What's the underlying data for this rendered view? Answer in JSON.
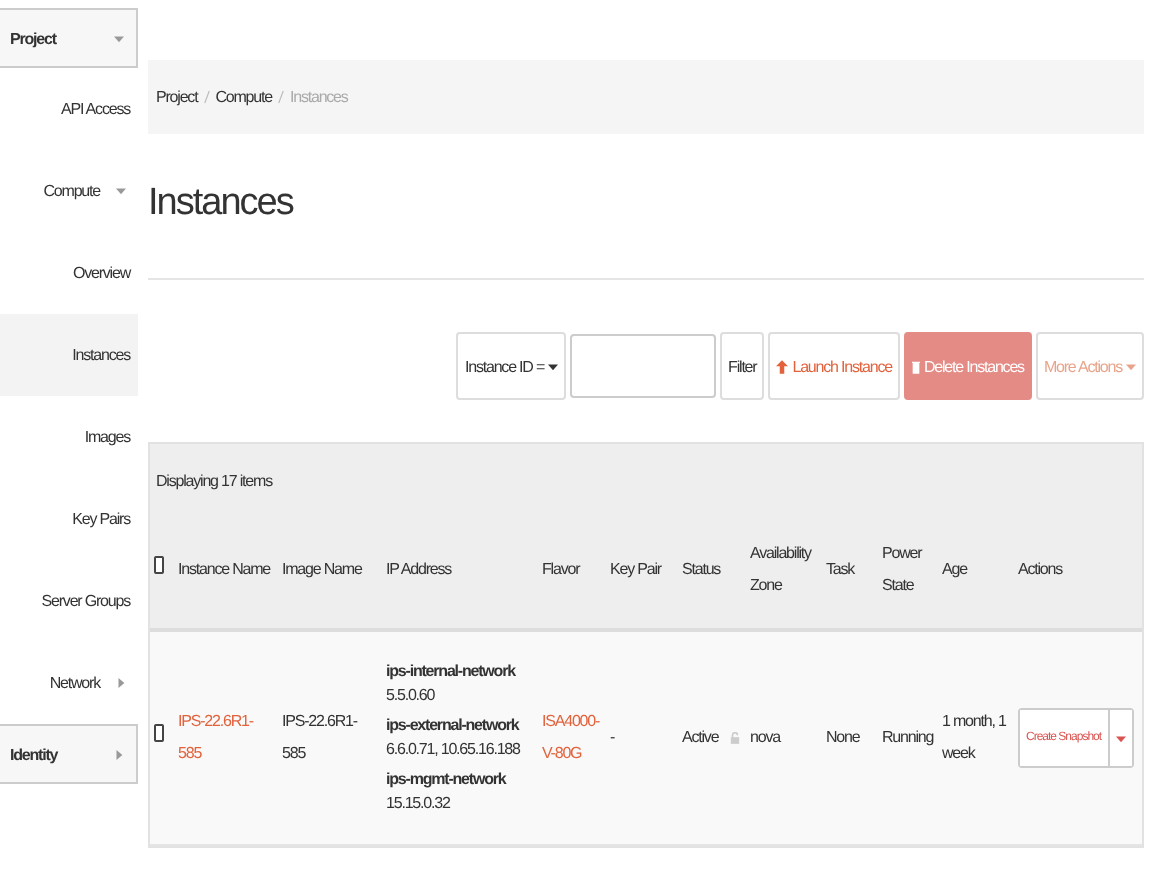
{
  "sidebar": {
    "items": [
      {
        "kind": "section",
        "label": "Project",
        "expanded": true
      },
      {
        "kind": "item",
        "label": "API Access",
        "selected": false
      },
      {
        "kind": "group",
        "label": "Compute",
        "expanded": true
      },
      {
        "kind": "item",
        "label": "Overview",
        "selected": false
      },
      {
        "kind": "item",
        "label": "Instances",
        "selected": true
      },
      {
        "kind": "item",
        "label": "Images",
        "selected": false
      },
      {
        "kind": "item",
        "label": "Key Pairs",
        "selected": false
      },
      {
        "kind": "item",
        "label": "Server Groups",
        "selected": false
      },
      {
        "kind": "group",
        "label": "Network",
        "expanded": false
      },
      {
        "kind": "section",
        "label": "Identity",
        "expanded": false
      }
    ]
  },
  "breadcrumb": [
    "Project",
    "Compute",
    "Instances"
  ],
  "title": "Instances",
  "toolbar": {
    "filter_select": "Instance ID =",
    "filter_button": "Filter",
    "launch_button": "Launch Instance",
    "delete_button": "Delete Instances",
    "more_button": "More Actions"
  },
  "table": {
    "summary": "Displaying 17 items",
    "all_checked": false,
    "columns": [
      "Instance Name",
      "Image Name",
      "IP Address",
      "Flavor",
      "Key Pair",
      "Status",
      "Availability Zone",
      "Task",
      "Power State",
      "Age",
      "Actions"
    ],
    "rows": [
      {
        "checked": false,
        "instance_name": "IPS-22.6R1-585",
        "image_name": "IPS-22.6R1-585",
        "ip_address": [
          "**ips-internal-network** 5.5.0.60",
          "**ips-external-network** 6.6.0.71, 10.65.16.188",
          "**ips-mgmt-network** 15.15.0.32"
        ],
        "flavor": "ISA4000-V-80G",
        "key_pair": "-",
        "status": "Active",
        "availability_zone": "nova",
        "task": "None",
        "power_state": "Running",
        "age": "1 month, 1 week",
        "action": "Create Snapshot"
      }
    ]
  }
}
